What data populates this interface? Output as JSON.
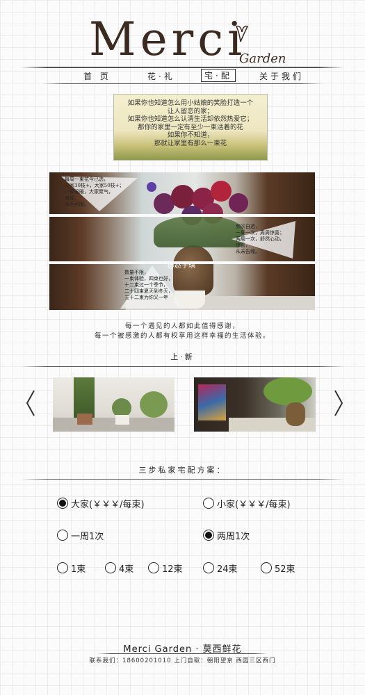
{
  "logo": {
    "main": "Merci",
    "sub": "Garden"
  },
  "nav": {
    "items": [
      {
        "label": "首 页"
      },
      {
        "label": "花·礼"
      },
      {
        "label": "宅·配"
      },
      {
        "label": "关于我们"
      }
    ],
    "active_index": 2
  },
  "intro": {
    "lines": [
      "如果你也知道怎么用小姑娘的笑脸打造一个",
      "让人留恋的家；",
      "如果你也知道怎么认清生活却依然热爱它；",
      "那你的家里一定有至少一束活着的花",
      "如果你不知道，",
      "那就让家里有那么一束花"
    ]
  },
  "hero": {
    "note_left": [
      "每周一束花今已选，",
      "小家30枝+，大家50枝+；",
      "小家温暖，大家聚气，",
      "幸福，",
      "从不闲眼。"
    ],
    "note_right": [
      "频次自选，",
      "一周一次，周周惊喜；",
      "两周一次，舒然心动，",
      "惊喜，",
      "从未告缘。"
    ],
    "note_bottom": [
      "数量不限，",
      "一束体验，四束也好，",
      "十二束过一个季节，",
      "二十四束夏天到冬天，",
      "五十二束为你又一年"
    ],
    "watermark": "@赵子琪"
  },
  "tagline": {
    "lines": [
      "每一个遇见的人都如此值得感谢，",
      "每一个被感激的人都有权享用这样幸福的生活体验。"
    ]
  },
  "new_section": {
    "title": "上·新"
  },
  "plan_section": {
    "title": "三步私家宅配方案："
  },
  "options": {
    "size": [
      {
        "label": "大家(￥￥￥/每束)",
        "selected": true
      },
      {
        "label": "小家(￥￥￥/每束)",
        "selected": false
      }
    ],
    "frequency": [
      {
        "label": "一周1次",
        "selected": false
      },
      {
        "label": "两周1次",
        "selected": true
      }
    ],
    "quantity": [
      {
        "label": "1束",
        "selected": false
      },
      {
        "label": "4束",
        "selected": false
      },
      {
        "label": "12束",
        "selected": false
      },
      {
        "label": "24束",
        "selected": false
      },
      {
        "label": "52束",
        "selected": false
      }
    ]
  },
  "footer": {
    "title": "Merci Garden · 莫西鲜花",
    "contact": "联系我们：18600201010  上门自取：朝阳望京 西园三区西门"
  },
  "colors": {
    "ink": "#2b2b2b",
    "grid": "#ececec"
  }
}
